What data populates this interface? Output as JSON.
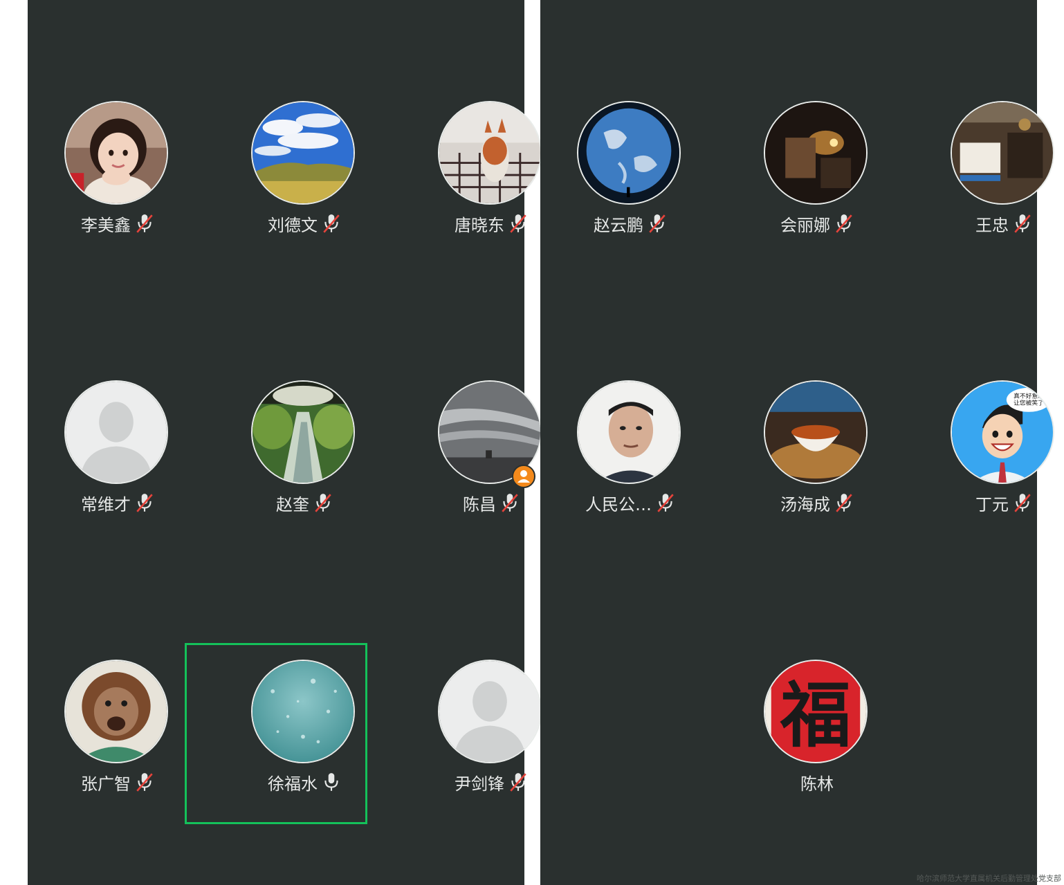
{
  "left_panel": {
    "participants": [
      {
        "name": "李美鑫",
        "mic": "muted",
        "avatar": "girl-photo"
      },
      {
        "name": "刘德文",
        "mic": "muted",
        "avatar": "sky-grassland"
      },
      {
        "name": "唐晓东",
        "mic": "muted",
        "avatar": "cat-on-blanket"
      },
      {
        "name": "常维才",
        "mic": "muted",
        "avatar": "default-silhouette"
      },
      {
        "name": "赵奎",
        "mic": "muted",
        "avatar": "forest-river"
      },
      {
        "name": "陈昌",
        "mic": "muted",
        "avatar": "cloudy-sky",
        "badge": "host-icon"
      },
      {
        "name": "张广智",
        "mic": "muted",
        "avatar": "orangutan"
      },
      {
        "name": "徐福水",
        "mic": "speaking",
        "avatar": "water-drops",
        "highlighted": true
      },
      {
        "name": "尹剑锋",
        "mic": "muted",
        "avatar": "default-silhouette"
      }
    ]
  },
  "right_panel": {
    "participants": [
      {
        "name": "赵云鹏",
        "mic": "muted",
        "avatar": "earth"
      },
      {
        "name": "会丽娜",
        "mic": "muted",
        "avatar": "candle-room"
      },
      {
        "name": "王忠",
        "mic": "muted",
        "avatar": "antique-shop"
      },
      {
        "name": "人民公…",
        "mic": "muted",
        "avatar": "man-portrait"
      },
      {
        "name": "汤海成",
        "mic": "muted",
        "avatar": "tea-cup"
      },
      {
        "name": "丁元",
        "mic": "muted",
        "avatar": "cartoon-man"
      },
      {
        "name": "陈林",
        "mic": "none",
        "avatar": "fu-calligraphy"
      }
    ]
  },
  "cartoon_bubble_text": "真不好意思让您被笑了",
  "fu_character": "福",
  "watermark": "哈尔滨师范大学直属机关后勤管理处党支部",
  "colors": {
    "panel_bg": "#2a302f",
    "speaking_frame": "#14c15a",
    "muted_slash": "#e5433b",
    "host_badge": "#f48a1c",
    "name_text": "#e6e8e7"
  }
}
